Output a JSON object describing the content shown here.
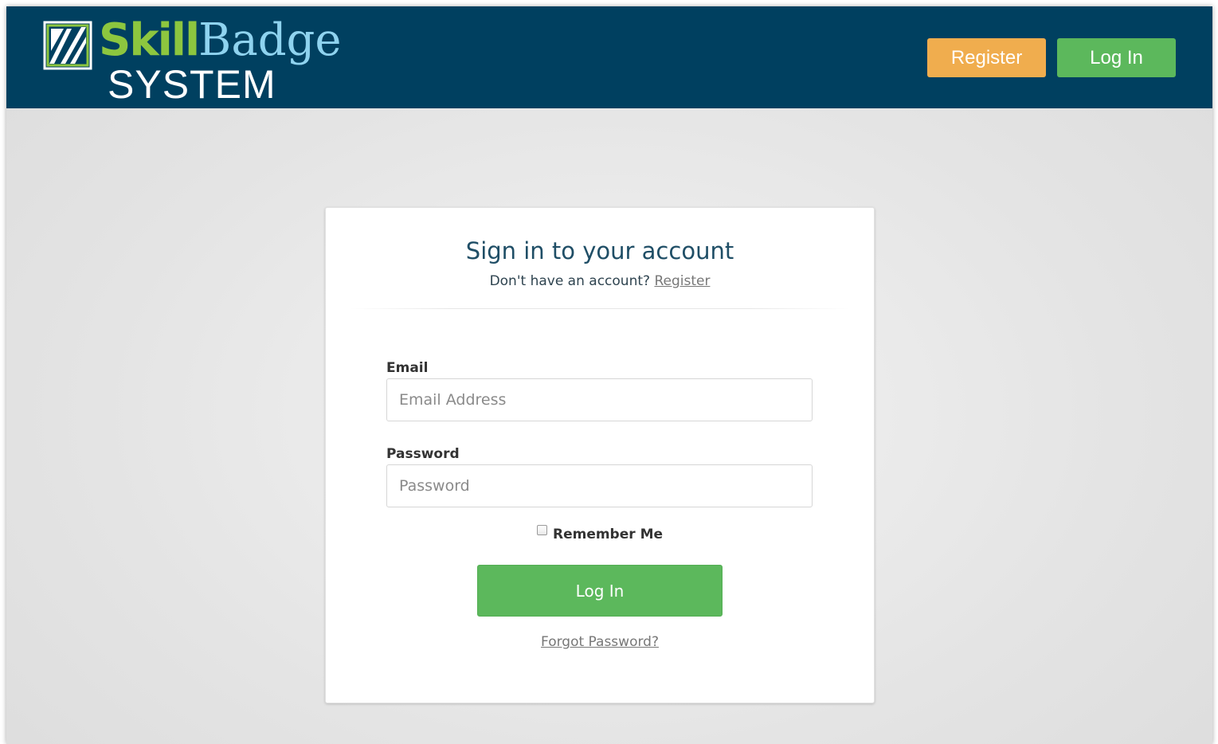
{
  "header": {
    "logo": {
      "line1_part1": "Skill",
      "line1_part2": "Badge",
      "line2": "SYSTEM"
    },
    "register_label": "Register",
    "login_label": "Log In"
  },
  "card": {
    "title": "Sign in to your account",
    "subtitle": "Don't have an account?",
    "register_link": "Register",
    "email": {
      "label": "Email",
      "placeholder": "Email Address",
      "value": ""
    },
    "password": {
      "label": "Password",
      "placeholder": "Password",
      "value": ""
    },
    "remember_label": "Remember Me",
    "remember_checked": false,
    "login_button": "Log In",
    "forgot_link": "Forgot Password?"
  },
  "colors": {
    "header_bg": "#004060",
    "brand_green": "#8dc63f",
    "brand_blue": "#8fd3ef",
    "register_orange": "#f0ad4e",
    "login_green": "#5cb85c",
    "title_blue": "#1f4e66"
  },
  "icons": {
    "logo_mark": "badge-logo-icon",
    "checkbox": "checkbox-icon"
  }
}
